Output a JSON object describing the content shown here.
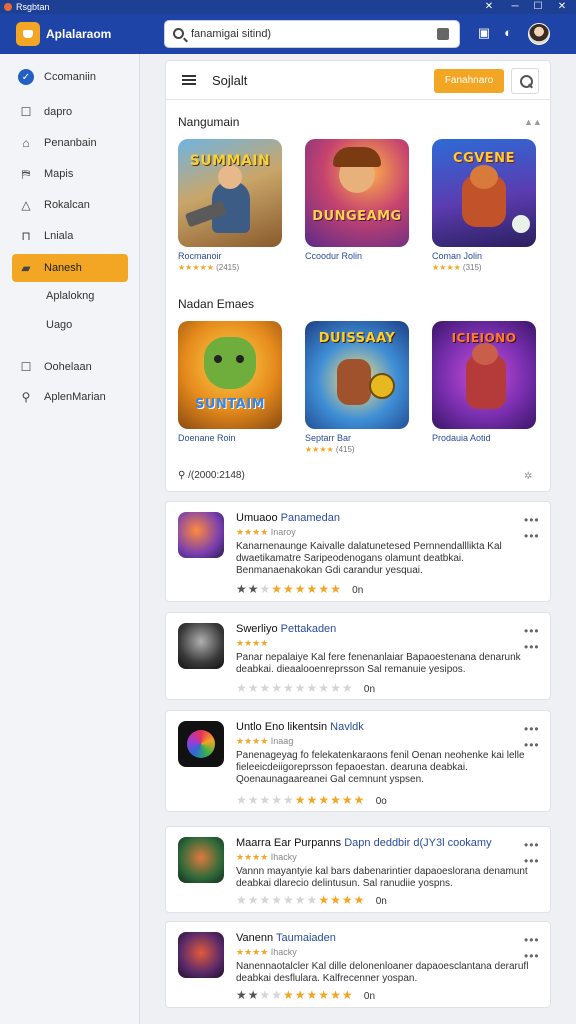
{
  "window": {
    "title": "Rsgbtan"
  },
  "header": {
    "app_name": "Aplalaraom",
    "search_value": "fanamigai sitind)"
  },
  "sidebar": {
    "items": [
      {
        "label": "Ccomaniin",
        "icon": "check-circle-icon"
      },
      {
        "label": "dapro",
        "icon": "square-icon"
      },
      {
        "label": "Penanbain",
        "icon": "home-icon"
      },
      {
        "label": "Mapis",
        "icon": "map-icon"
      },
      {
        "label": "Rokalcan",
        "icon": "triangle-icon"
      },
      {
        "label": "Lniala",
        "icon": "bag-icon"
      },
      {
        "label": "Nanesh",
        "icon": "bookmark-icon",
        "active": true
      },
      {
        "label": "Aplalokng",
        "icon": ""
      },
      {
        "label": "Uago",
        "icon": ""
      },
      {
        "label": "Oohelaan",
        "icon": "square-icon"
      },
      {
        "label": "AplenMarian",
        "icon": "wrench-icon"
      }
    ]
  },
  "toolbar": {
    "title": "Sojlalt",
    "button_label": "Fanahnaro"
  },
  "sections": [
    {
      "title": "Nangumain",
      "games": [
        {
          "art_title": "SUMMAIN",
          "name": "Rocmanoir",
          "rating": "(2415)"
        },
        {
          "art_title": "DUNGEAMG",
          "name": "Ccoodur Rolin",
          "rating": ""
        },
        {
          "art_title": "CGVENE",
          "name": "Coman Jolin",
          "rating": "(315)"
        }
      ]
    },
    {
      "title": "Nadan Emaes",
      "games": [
        {
          "art_title": "SUNTAIM",
          "name": "Doenane Roin",
          "rating": ""
        },
        {
          "art_title": "DUISSAAY",
          "name": "Septarr Bar",
          "rating": "(415)"
        },
        {
          "art_title": "ICIEIONO",
          "name": "Prodauia Aotid",
          "rating": ""
        }
      ]
    }
  ],
  "footer_text": "/(2000:2148)",
  "reviews": [
    {
      "title": "Umuaoo",
      "publisher": "Panamedan",
      "sub": "Inaroy",
      "body": "Kanarnenaunge Kaivalle dalatunetesed Pernnendalllikta Kal dwaetikamatre Saripeodenogans olamunt deatbkai. Benmanaenakokan Gdi carandur yesquai.",
      "count": "0n"
    },
    {
      "title": "Swerliyo",
      "publisher": "Pettakaden",
      "sub": "",
      "body": "Panar nepalaiye Kal fere fenenanlaiar Bapaoestenana denarunk deabkai. dieaalooenreprsson Sal remanuie yesipos.",
      "count": "0n"
    },
    {
      "title": "Untlo Eno likentsin",
      "publisher": "Navldk",
      "sub": "Inaag",
      "body": "Panenageyag fo felekatenkaraons fenil Oenan neohenke kai lelle fieleeicdeiigoreprsson fepaoestan. dearuna deabkai. Qoenaunagaareanei Gal cemnunt yspsen.",
      "count": "0o"
    },
    {
      "title": "Maarra Ear Purpanns",
      "publisher": "Dapn deddbir d(JY3l cookamy",
      "sub": "Ihacky",
      "body": "Vannn mayantyie kal bars dabenarintier dapaoeslorana denamunt deabkai dlarecio delintusun. Sal ranudiie yospns.",
      "count": "0n"
    },
    {
      "title": "Vanenn",
      "publisher": "Taumaiaden",
      "sub": "Ihacky",
      "body": "Nanennaotalcler Kal dille delonenloaner dapaoesclantana derarufl deabkai desflulara. Kalfrecenner yospan.",
      "count": "0n"
    }
  ],
  "colors": {
    "header": "#1f44a8",
    "accent": "#f2a623",
    "link": "#2b4c9c"
  }
}
